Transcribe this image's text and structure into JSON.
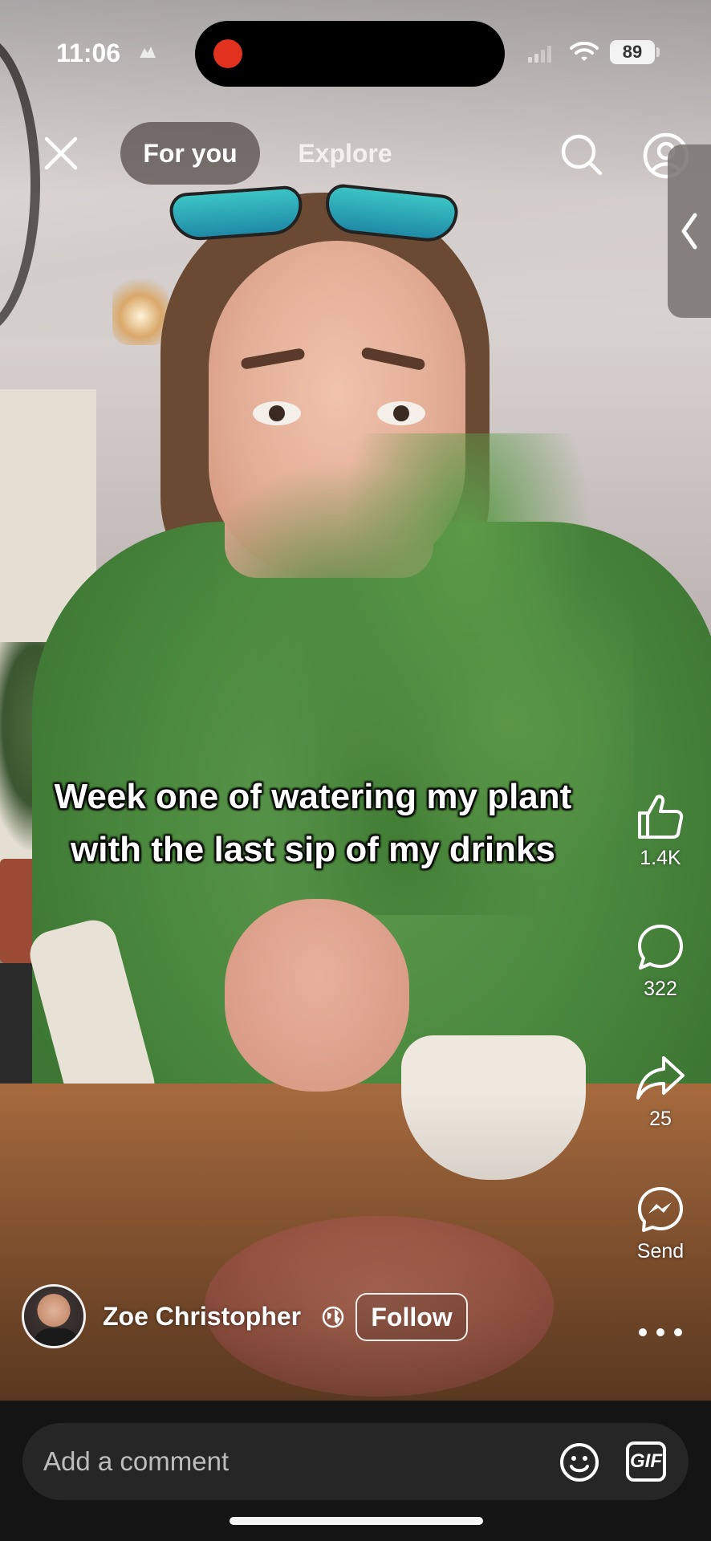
{
  "status_bar": {
    "time": "11:06",
    "battery": "89",
    "icons": [
      "do-not-disturb-icon",
      "signal-icon",
      "wifi-icon",
      "battery-icon"
    ]
  },
  "top_nav": {
    "close_icon": "close-icon",
    "tabs": [
      {
        "label": "For you",
        "active": true
      },
      {
        "label": "Explore",
        "active": false
      }
    ],
    "search_icon": "search-icon",
    "profile_icon": "profile-icon",
    "side_panel_icon": "chevron-left-icon"
  },
  "video": {
    "caption": "Week one of watering my plant with the last sip of my drinks"
  },
  "actions": {
    "like": {
      "icon": "thumbs-up-icon",
      "count": "1.4K"
    },
    "comment": {
      "icon": "comment-icon",
      "count": "322"
    },
    "share": {
      "icon": "share-icon",
      "count": "25"
    },
    "send": {
      "icon": "messenger-icon",
      "label": "Send"
    },
    "more_icon": "more-dots-icon"
  },
  "creator": {
    "name": "Zoe Christopher",
    "privacy_icon": "globe-icon",
    "follow_label": "Follow"
  },
  "comment_bar": {
    "placeholder": "Add a comment",
    "emoji_icon": "emoji-icon",
    "gif_label": "GIF"
  },
  "colors": {
    "record_dot": "#e2321f",
    "bottom_bar": "#141414",
    "comment_field": "#262626",
    "active_tab_bg": "#504846"
  }
}
